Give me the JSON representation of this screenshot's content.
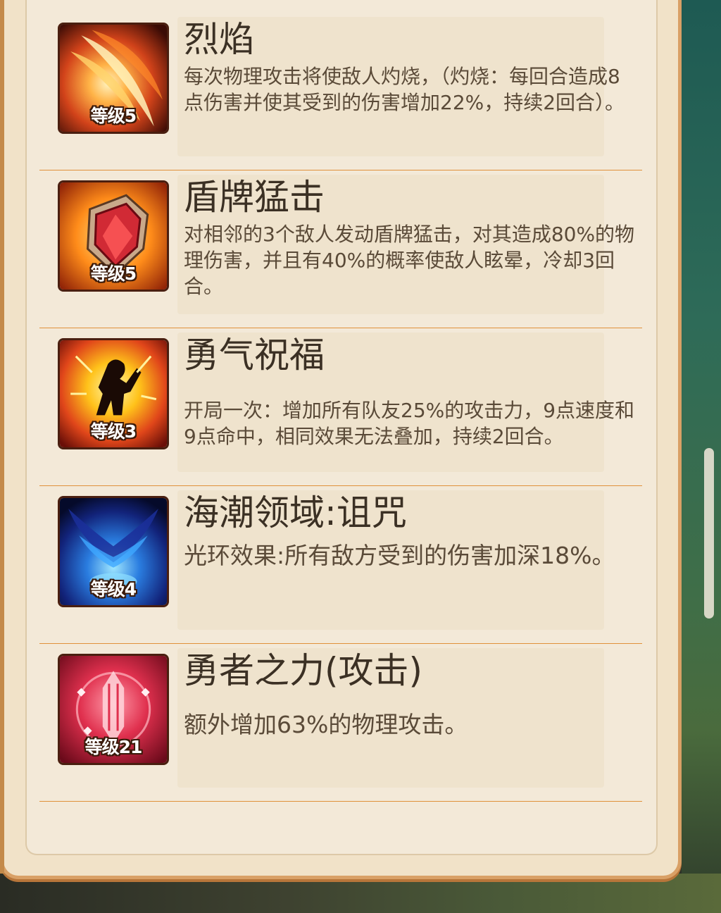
{
  "skills": [
    {
      "name": "烈焰",
      "level": "等级5",
      "icon": "flame-slash-icon",
      "description": "每次物理攻击将使敌人灼烧，（灼烧：每回合造成8点伤害并使其受到的伤害增加22%，持续2回合）。"
    },
    {
      "name": "盾牌猛击",
      "level": "等级5",
      "icon": "shield-bash-icon",
      "description": "对相邻的3个敌人发动盾牌猛击，对其造成80%的物理伤害，并且有40%的概率使敌人眩晕，冷却3回合。"
    },
    {
      "name": "勇气祝福",
      "level": "等级3",
      "icon": "courage-blessing-icon",
      "description": "开局一次：增加所有队友25%的攻击力，9点速度和9点命中，相同效果无法叠加，持续2回合。"
    },
    {
      "name": "海潮领域:诅咒",
      "level": "等级4",
      "icon": "tide-curse-icon",
      "description": "光环效果:所有敌方受到的伤害加深18%。"
    },
    {
      "name": "勇者之力(攻击)",
      "level": "等级21",
      "icon": "sword-crest-icon",
      "description": "额外增加63%的物理攻击。"
    }
  ],
  "colors": {
    "panel": "#f3e9d8",
    "divider": "#e0913a",
    "title": "#3b3024",
    "text": "#5a4a38"
  }
}
